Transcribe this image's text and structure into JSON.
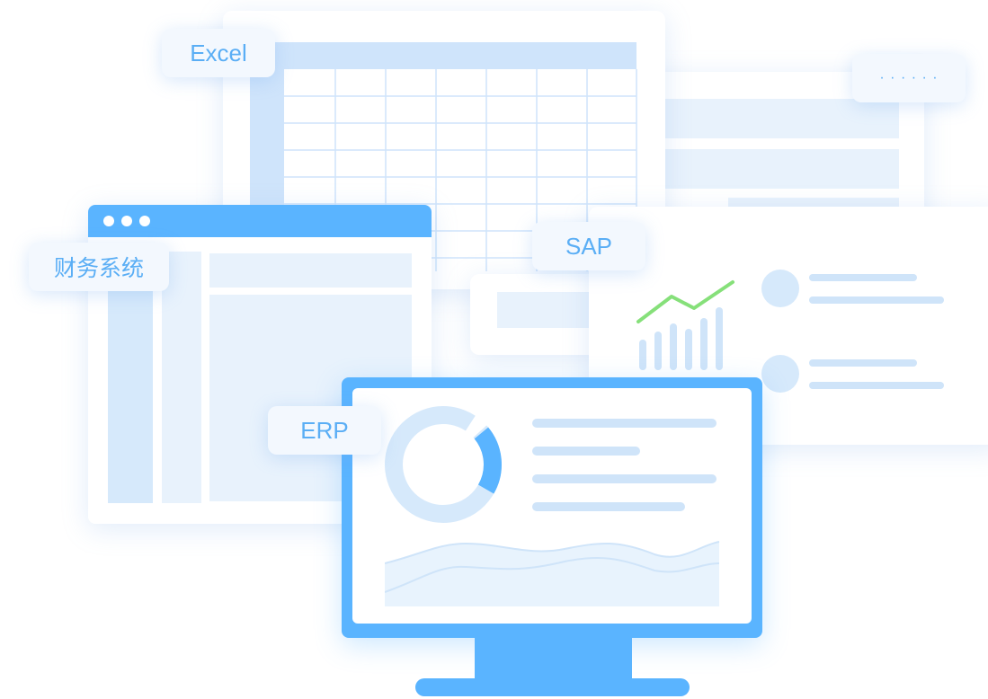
{
  "tags": {
    "excel": "Excel",
    "ellipsis": "· · · · · ·",
    "finance": "财务系统",
    "sap": "SAP",
    "erp": "ERP"
  },
  "icons": [
    "window-dots-icon",
    "spreadsheet-icon",
    "donut-chart-icon",
    "line-chart-icon",
    "bar-chart-icon",
    "monitor-icon"
  ],
  "colors": {
    "accent": "#5ab4ff",
    "light_blue": "#cfe4f9",
    "green_line": "#86e07a",
    "text_blue": "#5aaef5"
  }
}
